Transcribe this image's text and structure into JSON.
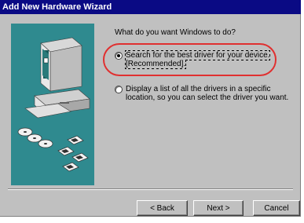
{
  "window": {
    "title": "Add New Hardware Wizard"
  },
  "main": {
    "prompt": "What do you want Windows to do?",
    "options": [
      {
        "label": "Search for the best driver for your device. [Recommended].",
        "selected": true
      },
      {
        "label": "Display a list of all the drivers in a specific location, so you can select the driver you want.",
        "selected": false
      }
    ]
  },
  "buttons": {
    "back": "< Back",
    "next": "Next >",
    "cancel": "Cancel"
  },
  "colors": {
    "titlebar": "#0a0a84",
    "highlight_oval": "#e03030",
    "dialog_face": "#c0c0c0",
    "art_panel": "#2f8a8f"
  },
  "icons": [
    "computer-icon",
    "cd-disc-icon",
    "floppy-disk-icon"
  ]
}
